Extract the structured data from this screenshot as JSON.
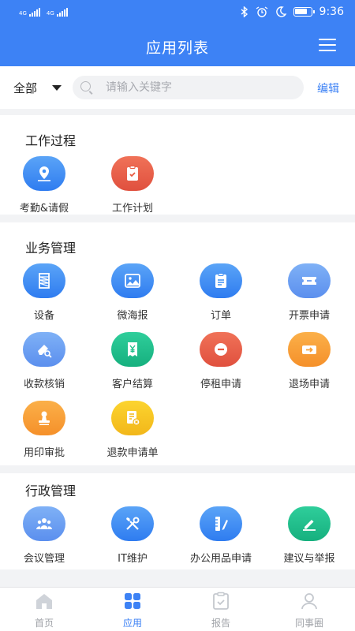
{
  "status_bar": {
    "network_1": "4G",
    "network_2": "4G",
    "time": "9:36"
  },
  "header": {
    "title": "应用列表"
  },
  "search": {
    "scope": "全部",
    "placeholder": "请输入关键字",
    "edit_label": "编辑"
  },
  "sections": [
    {
      "title": "工作过程",
      "items": [
        {
          "label": "考勤&请假",
          "icon": "location-pin-icon",
          "color": "#3f8ff4"
        },
        {
          "label": "工作计划",
          "icon": "clipboard-check-icon",
          "color": "#e8593f"
        }
      ]
    },
    {
      "title": "业务管理",
      "items": [
        {
          "label": "设备",
          "icon": "scaffold-icon",
          "color": "#3f8ff4"
        },
        {
          "label": "微海报",
          "icon": "image-icon",
          "color": "#3f8ff4"
        },
        {
          "label": "订单",
          "icon": "order-clipboard-icon",
          "color": "#3f8ff4"
        },
        {
          "label": "开票申请",
          "icon": "ticket-icon",
          "color": "#6a9cf1"
        },
        {
          "label": "收款核销",
          "icon": "eraser-search-icon",
          "color": "#6a9cf1"
        },
        {
          "label": "客户结算",
          "icon": "receipt-yen-icon",
          "color": "#22c08c"
        },
        {
          "label": "停租申请",
          "icon": "stop-minus-icon",
          "color": "#e8593f"
        },
        {
          "label": "退场申请",
          "icon": "exit-arrow-icon",
          "color": "#f8a13a"
        },
        {
          "label": "用印审批",
          "icon": "stamp-icon",
          "color": "#f8a13a"
        },
        {
          "label": "退款申请单",
          "icon": "refund-doc-icon",
          "color": "#f7c522"
        }
      ]
    },
    {
      "title": "行政管理",
      "items": [
        {
          "label": "会议管理",
          "icon": "people-icon",
          "color": "#6a9cf1"
        },
        {
          "label": "IT维护",
          "icon": "wrench-screwdriver-icon",
          "color": "#3f8ff4"
        },
        {
          "label": "办公用品申请",
          "icon": "ruler-pencil-icon",
          "color": "#3f8ff4"
        },
        {
          "label": "建议与举报",
          "icon": "pencil-note-icon",
          "color": "#22c08c"
        }
      ]
    }
  ],
  "tabbar": [
    {
      "label": "首页",
      "icon": "home-icon",
      "active": false
    },
    {
      "label": "应用",
      "icon": "apps-grid-icon",
      "active": true
    },
    {
      "label": "报告",
      "icon": "report-icon",
      "active": false
    },
    {
      "label": "同事圈",
      "icon": "person-icon",
      "active": false
    }
  ],
  "colors": {
    "primary": "#3d82f5",
    "background": "#f2f3f5"
  }
}
